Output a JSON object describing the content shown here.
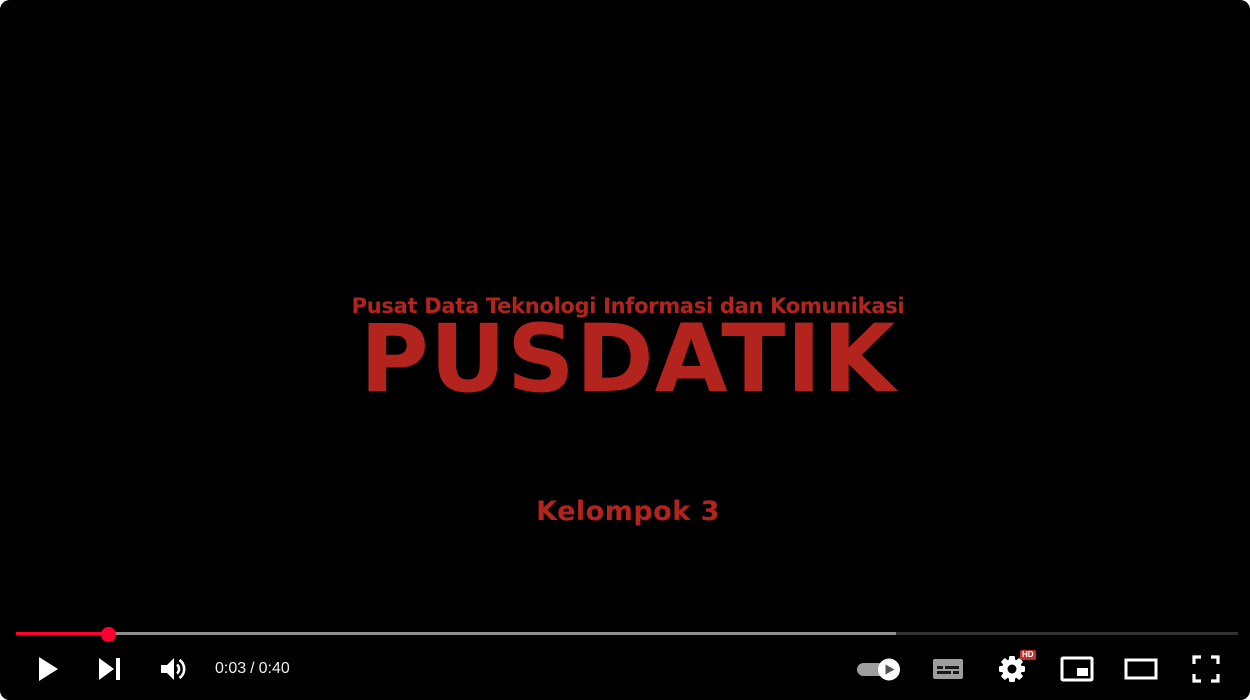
{
  "video": {
    "subtitle": "Pusat Data Teknologi Informasi dan Komunikasi",
    "title": "PUSDATIK",
    "group": "Kelompok 3",
    "text_color": "#b3241f"
  },
  "player": {
    "time_current": "0:03",
    "time_separator": "/",
    "time_total": "0:40",
    "progress_fraction": 0.075,
    "buffered_fraction": 0.72,
    "accent_color": "#ff0033",
    "quality_badge": "HD",
    "controls_left": [
      "play-icon",
      "next-icon",
      "volume-icon"
    ],
    "controls_right": [
      "autoplay-toggle-icon",
      "subtitles-icon",
      "settings-icon",
      "miniplayer-icon",
      "theater-mode-icon",
      "fullscreen-icon"
    ]
  }
}
